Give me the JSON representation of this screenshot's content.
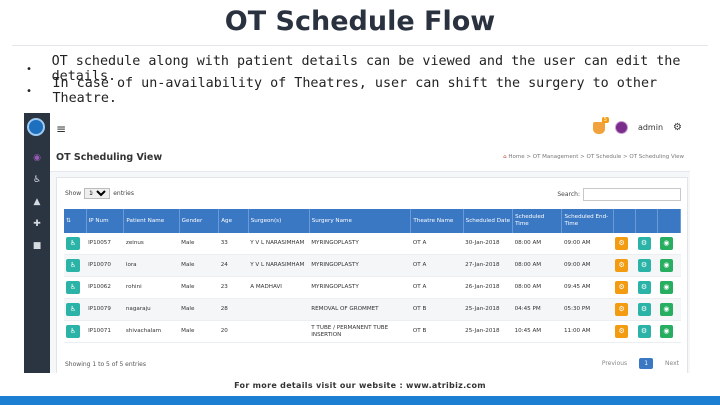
{
  "slide": {
    "title": "OT Schedule Flow",
    "bullets": [
      "OT schedule along with patient details can be viewed and the user can edit the details.",
      "In case of un-availability of Theatres, user can shift the surgery to other Theatre."
    ],
    "footer": "For more details visit our website : www.atribiz.com"
  },
  "app": {
    "topbar": {
      "notification_count": "5",
      "user": "admin"
    },
    "page_title": "OT Scheduling View",
    "breadcrumb": {
      "home": "Home",
      "sep": ">",
      "l2": "OT Management",
      "l3": "OT Schedule",
      "l4": "OT Scheduling View"
    },
    "show_label": "Show",
    "show_value": "10",
    "entries_label": "entries",
    "search_label": "Search:",
    "columns": [
      "IP Num",
      "Patient Name",
      "Gender",
      "Age",
      "Surgeon(s)",
      "Surgery Name",
      "Theatre Name",
      "Scheduled Date",
      "Scheduled Time",
      "Scheduled End-Time"
    ],
    "rows": [
      {
        "ip": "IP10057",
        "name": "zeinus",
        "gender": "Male",
        "age": "33",
        "surgeon": "Y V L NARASIMHAM",
        "surgery": "MYRINGOPLASTY",
        "theatre": "OT A",
        "date": "30-Jan-2018",
        "time": "08:00 AM",
        "end": "09:00 AM"
      },
      {
        "ip": "IP10070",
        "name": "lora",
        "gender": "Male",
        "age": "24",
        "surgeon": "Y V L NARASIMHAM",
        "surgery": "MYRINGOPLASTY",
        "theatre": "OT A",
        "date": "27-Jan-2018",
        "time": "08:00 AM",
        "end": "09:00 AM"
      },
      {
        "ip": "IP10062",
        "name": "rohini",
        "gender": "Male",
        "age": "23",
        "surgeon": "A MADHAVI",
        "surgery": "MYRINGOPLASTY",
        "theatre": "OT A",
        "date": "26-Jan-2018",
        "time": "08:00 AM",
        "end": "09:45 AM"
      },
      {
        "ip": "IP10079",
        "name": "nagaraju",
        "gender": "Male",
        "age": "28",
        "surgeon": "",
        "surgery": "REMOVAL OF GROMMET",
        "theatre": "OT B",
        "date": "25-Jan-2018",
        "time": "04:45 PM",
        "end": "05:30 PM"
      },
      {
        "ip": "IP10071",
        "name": "shivachalam",
        "gender": "Male",
        "age": "20",
        "surgeon": "",
        "surgery": "T TUBE / PERMANENT TUBE INSERTION",
        "theatre": "OT B",
        "date": "25-Jan-2018",
        "time": "10:45 AM",
        "end": "11:00 AM"
      }
    ],
    "showing_text": "Showing 1 to 5 of 5 entries",
    "pager": {
      "prev": "Previous",
      "current": "1",
      "next": "Next"
    }
  },
  "colors": {
    "header_blue": "#3b78c4",
    "sidebar": "#2b3441",
    "teal": "#2bb3a8",
    "orange": "#f39c12",
    "green": "#27ae60",
    "bottom_bar": "#1d7fd1"
  }
}
